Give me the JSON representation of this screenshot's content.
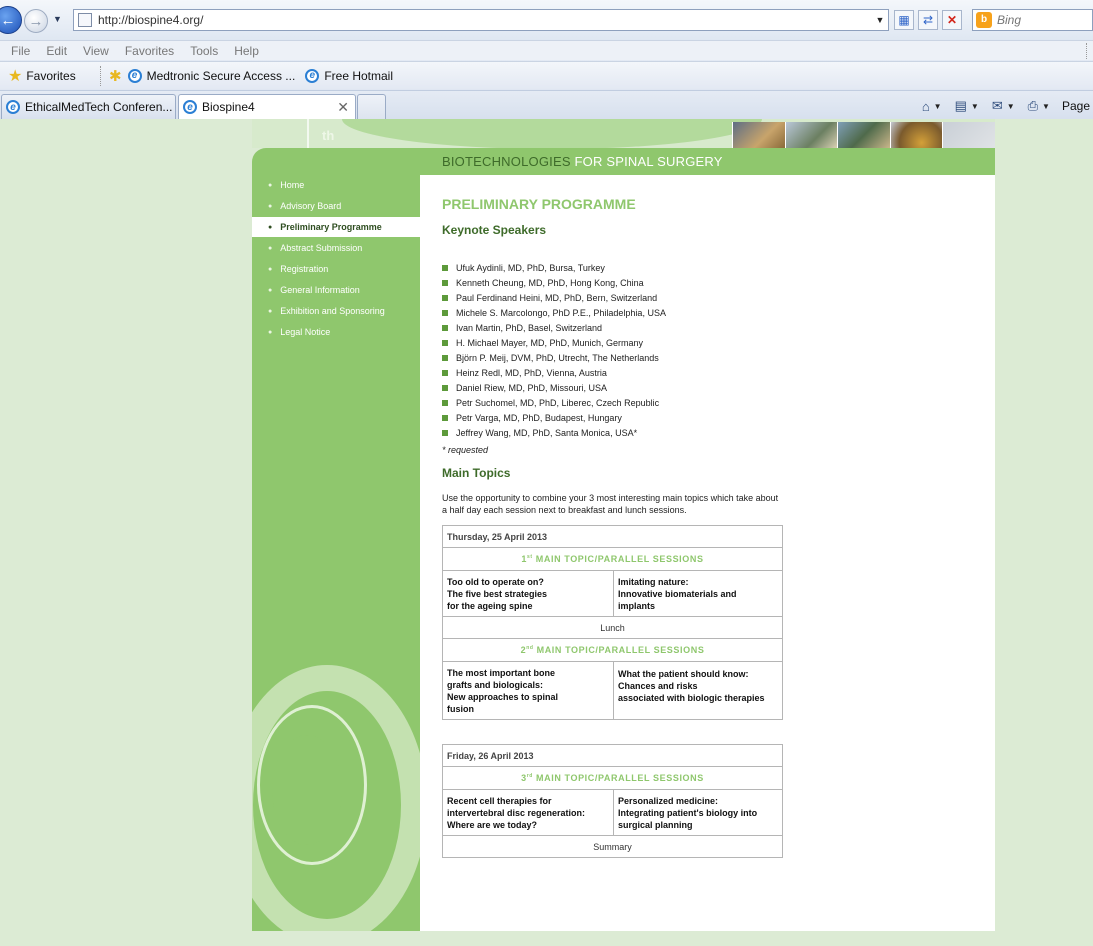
{
  "browser": {
    "url": "http://biospine4.org/",
    "search_placeholder": "Bing",
    "menu": [
      "File",
      "Edit",
      "View",
      "Favorites",
      "Tools",
      "Help"
    ],
    "favorites_label": "Favorites",
    "favorites_links": [
      "Medtronic Secure Access ...",
      "Free Hotmail"
    ],
    "tabs": [
      "EthicalMedTech Conferen...",
      "Biospine4"
    ],
    "command_page_label": "Page"
  },
  "site": {
    "th_mark": "th",
    "banner": {
      "main": "BIOTECHNOLOGIES ",
      "accent": "FOR SPINAL SURGERY"
    },
    "nav": [
      "Home",
      "Advisory Board",
      "Preliminary Programme",
      "Abstract Submission",
      "Registration",
      "General Information",
      "Exhibition and Sponsoring",
      "Legal Notice"
    ],
    "active_nav": "Preliminary Programme"
  },
  "content": {
    "page_heading": "PRELIMINARY PROGRAMME",
    "keynote_heading": "Keynote Speakers",
    "speakers": [
      "Ufuk Aydinli, MD, PhD, Bursa, Turkey",
      "Kenneth Cheung, MD, PhD, Hong Kong, China",
      "Paul Ferdinand Heini, MD, PhD, Bern, Switzerland",
      "Michele S. Marcolongo, PhD P.E., Philadelphia, USA",
      "Ivan Martin, PhD, Basel, Switzerland",
      "H. Michael Mayer, MD, PhD, Munich, Germany",
      "Björn P. Meij, DVM, PhD, Utrecht, The Netherlands",
      "Heinz Redl, MD, PhD, Vienna, Austria",
      "Daniel Riew, MD, PhD, Missouri, USA",
      "Petr Suchomel, MD, PhD, Liberec, Czech Republic",
      "Petr Varga, MD, PhD, Budapest, Hungary",
      "Jeffrey Wang, MD, PhD, Santa Monica, USA*"
    ],
    "requested_note": "* requested",
    "topics_heading": "Main Topics",
    "topics_intro": "Use the opportunity to combine your 3 most interesting main topics which take about a half day each session next to breakfast and lunch sessions.",
    "thursday": {
      "day": "Thursday, 25 April 2013",
      "topic1": {
        "num": "1",
        "sup": "st",
        "label": " MAIN TOPIC/PARALLEL SESSIONS"
      },
      "session1_left": [
        "Too old to operate on?",
        "The five best strategies",
        "for the ageing spine"
      ],
      "session1_right": [
        "Imitating nature:",
        "Innovative biomaterials and",
        "implants"
      ],
      "break": "Lunch",
      "topic2": {
        "num": "2",
        "sup": "nd",
        "label": " MAIN TOPIC/PARALLEL SESSIONS"
      },
      "session2_left": [
        "The most important bone",
        "grafts and biologicals:",
        "New approaches to spinal",
        "fusion"
      ],
      "session2_right": [
        "What the patient should know:",
        "Chances and risks",
        "associated with biologic therapies"
      ]
    },
    "friday": {
      "day": "Friday, 26 April 2013",
      "topic3": {
        "num": "3",
        "sup": "rd",
        "label": " MAIN TOPIC/PARALLEL SESSIONS"
      },
      "session3_left": [
        "Recent cell therapies for",
        "intervertebral disc regeneration:",
        "Where are we today?"
      ],
      "session3_right": [
        "Personalized medicine:",
        "Integrating patient's biology into",
        "surgical planning"
      ],
      "closing": "Summary"
    }
  }
}
